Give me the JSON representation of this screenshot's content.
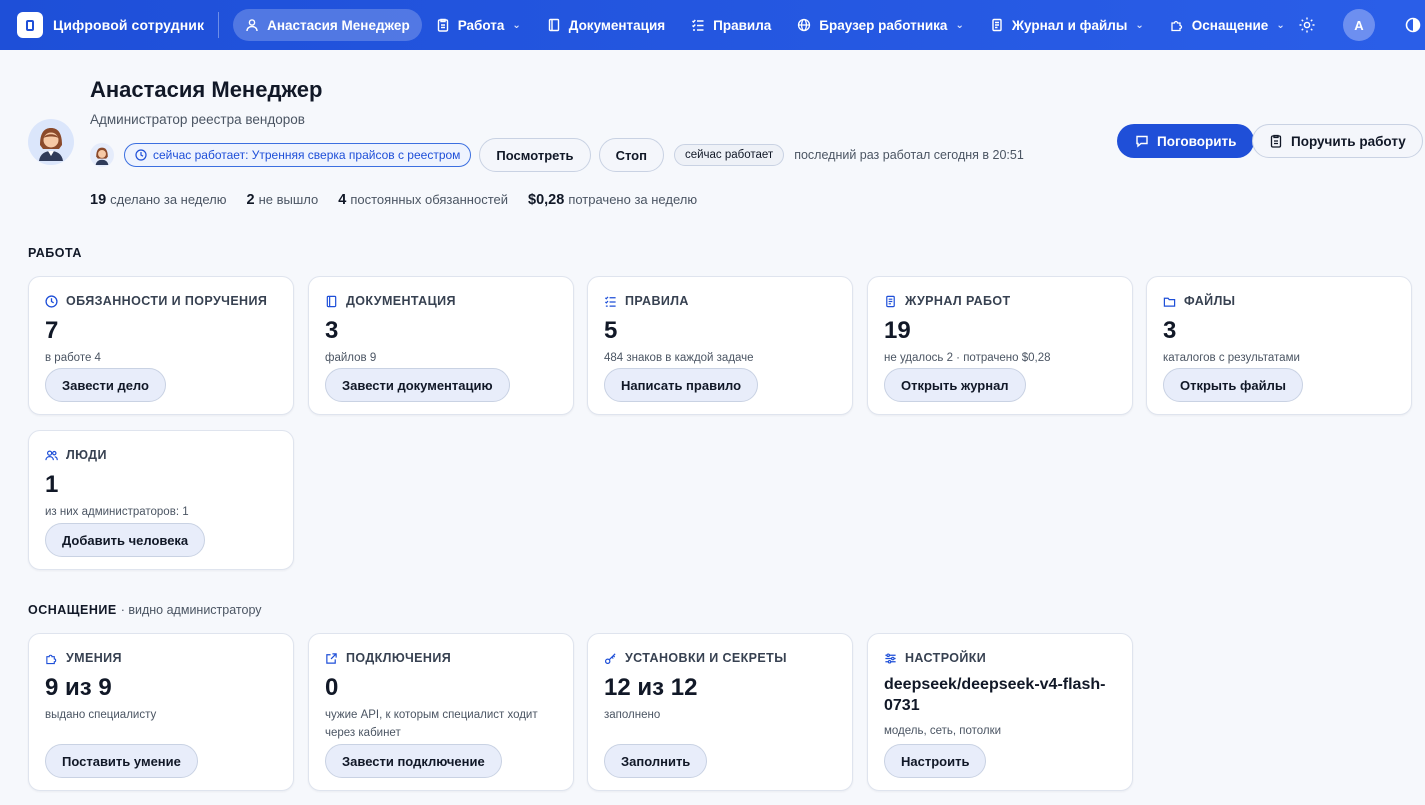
{
  "nav": {
    "brand": "Цифровой сотрудник",
    "items": [
      {
        "label": "Анастасия Менеджер",
        "icon": "user-icon",
        "active": true,
        "dropdown": false
      },
      {
        "label": "Работа",
        "icon": "clipboard-icon",
        "active": false,
        "dropdown": true
      },
      {
        "label": "Документация",
        "icon": "book-icon",
        "active": false,
        "dropdown": false
      },
      {
        "label": "Правила",
        "icon": "list-check-icon",
        "active": false,
        "dropdown": false
      },
      {
        "label": "Браузер работника",
        "icon": "globe-icon",
        "active": false,
        "dropdown": true
      },
      {
        "label": "Журнал и файлы",
        "icon": "journal-icon",
        "active": false,
        "dropdown": true
      },
      {
        "label": "Оснащение",
        "icon": "puzzle-icon",
        "active": false,
        "dropdown": true
      }
    ],
    "avatar_letter": "А"
  },
  "profile": {
    "name": "Анастасия Менеджер",
    "role": "Администратор реестра вендоров",
    "working_now": "сейчас работает: Утренняя сверка прайсов с реестром",
    "view_button": "Посмотреть",
    "stop_button": "Стоп",
    "status_chip": "сейчас работает",
    "last_seen": "последний раз работал сегодня в 20:51",
    "talk_button": "Поговорить",
    "assign_button": "Поручить работу"
  },
  "stats": [
    {
      "value": "19",
      "label": "сделано за неделю"
    },
    {
      "value": "2",
      "label": "не вышло"
    },
    {
      "value": "4",
      "label": "постоянных обязанностей"
    },
    {
      "value": "$0,28",
      "label": "потрачено за неделю"
    }
  ],
  "work_section": {
    "title": "РАБОТА",
    "cards": [
      {
        "title": "ОБЯЗАННОСТИ И ПОРУЧЕНИЯ",
        "icon": "clock-icon",
        "value": "7",
        "sub": "в работе 4",
        "button": "Завести дело"
      },
      {
        "title": "ДОКУМЕНТАЦИЯ",
        "icon": "book-icon",
        "value": "3",
        "sub": "файлов 9",
        "button": "Завести документацию"
      },
      {
        "title": "ПРАВИЛА",
        "icon": "list-check-icon",
        "value": "5",
        "sub": "484 знаков в каждой задаче",
        "button": "Написать правило"
      },
      {
        "title": "ЖУРНАЛ РАБОТ",
        "icon": "journal-icon",
        "value": "19",
        "sub": "не удалось 2 · потрачено $0,28",
        "button": "Открыть журнал"
      },
      {
        "title": "ФАЙЛЫ",
        "icon": "folder-icon",
        "value": "3",
        "sub": "каталогов с результатами",
        "button": "Открыть файлы"
      },
      {
        "title": "ЛЮДИ",
        "icon": "people-icon",
        "value": "1",
        "sub": "из них администраторов: 1",
        "button": "Добавить человека"
      }
    ]
  },
  "equipment_section": {
    "title": "ОСНАЩЕНИЕ",
    "subtitle": "· видно администратору",
    "cards": [
      {
        "title": "УМЕНИЯ",
        "icon": "puzzle-icon",
        "value": "9 из 9",
        "sub": "выдано специалисту",
        "button": "Поставить умение"
      },
      {
        "title": "ПОДКЛЮЧЕНИЯ",
        "icon": "external-link-icon",
        "value": "0",
        "sub": "чужие API, к которым специалист ходит через кабинет",
        "button": "Завести подключение"
      },
      {
        "title": "УСТАНОВКИ И СЕКРЕТЫ",
        "icon": "key-icon",
        "value": "12 из 12",
        "sub": "заполнено",
        "button": "Заполнить"
      },
      {
        "title": "НАСТРОЙКИ",
        "icon": "sliders-icon",
        "value": "deepseek/deepseek-v4-flash-0731",
        "sub": "модель, сеть, потолки",
        "button": "Настроить"
      }
    ]
  },
  "colors": {
    "primary": "#1f4fd8",
    "nav_bg": "#2a5ee8",
    "page_bg": "#f6f8fc"
  }
}
